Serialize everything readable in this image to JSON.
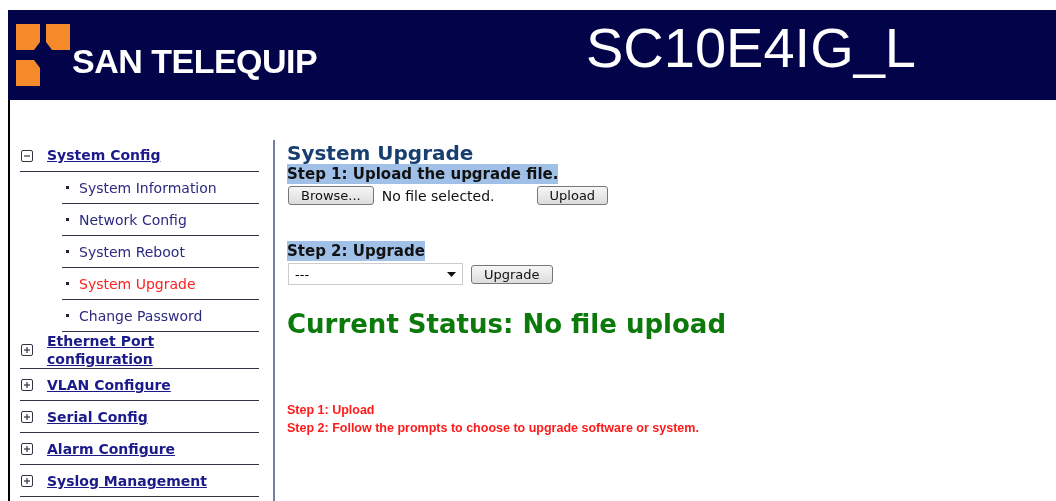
{
  "header": {
    "brand": "SAN TELEQUIP",
    "model": "SC10E4IG_L"
  },
  "menu": [
    {
      "label": "System Config",
      "expanded": true,
      "children": [
        {
          "label": "System Information",
          "selected": false
        },
        {
          "label": "Network Config",
          "selected": false
        },
        {
          "label": "System Reboot",
          "selected": false
        },
        {
          "label": "System Upgrade",
          "selected": true
        },
        {
          "label": "Change Password",
          "selected": false
        }
      ]
    },
    {
      "label": "Ethernet Port configuration",
      "expanded": false
    },
    {
      "label": "VLAN Configure",
      "expanded": false
    },
    {
      "label": "Serial Config",
      "expanded": false
    },
    {
      "label": "Alarm Configure",
      "expanded": false
    },
    {
      "label": "Syslog Management",
      "expanded": false
    }
  ],
  "page_title": "System Upgrade",
  "step1": {
    "heading": "Step 1: Upload the upgrade file.",
    "browse_button": "Browse...",
    "file_status": "No file selected.",
    "upload_button": "Upload"
  },
  "step2": {
    "heading": "Step 2: Upgrade",
    "select_value": "---",
    "upgrade_button": "Upgrade"
  },
  "current_status": "Current Status: No file upload",
  "notes": [
    "Step 1: Upload",
    "Step 2: Follow the prompts to choose to upgrade software or system."
  ]
}
